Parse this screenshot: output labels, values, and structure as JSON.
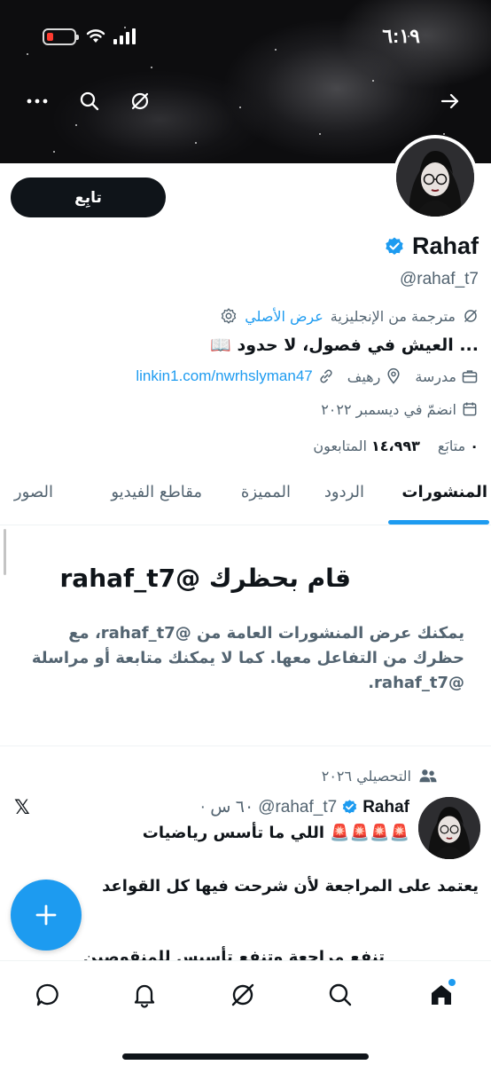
{
  "status_bar": {
    "time": "٦:١٩"
  },
  "profile": {
    "display_name": "Rahaf",
    "handle": "@rahaf_t7",
    "follow_label": "تابِع",
    "translated_label": "مترجمة من الإنجليزية",
    "show_original_label": "عرض الأصلي",
    "bio": "... العيش في فصول، لا حدود 📖",
    "profession": "مدرسة",
    "location": "رهيف",
    "website": "linkin1.com/nwrhslyman47",
    "joined": "انضمّ في ديسمبر ٢٠٢٢",
    "following_count": "٠",
    "following_label": "متابَع",
    "followers_count": "١٤،٩٩٣",
    "followers_label": "المتابعون"
  },
  "tabs": [
    {
      "label": "المنشورات",
      "active": true
    },
    {
      "label": "الردود",
      "active": false
    },
    {
      "label": "المميزة",
      "active": false
    },
    {
      "label": "مقاطع الفيديو",
      "active": false
    },
    {
      "label": "الصور",
      "active": false
    }
  ],
  "blocked_notice": {
    "title": "قام بحظرك @rahaf_t7",
    "text": "يمكنك عرض المنشورات العامة من @rahaf_t7، مع حظرك من التفاعل معها. كما لا يمكنك متابعة أو مراسلة @rahaf_t7."
  },
  "post": {
    "community": "التحصيلي ٢٠٢٦",
    "author_name": "Rahaf",
    "author_handle": "@rahaf_t7",
    "time": "· ٦٠ س",
    "line1": "🚨🚨🚨🚨 اللي ما تأسس رياضيات",
    "line2": "يعتمد على المراجعة لأن شرحت فيها كل القواعد",
    "line3": "تنفع مراجعة وتنفع تأسيس للمنقوصين"
  },
  "icons": {
    "header": [
      "back-arrow-icon",
      "grok-icon",
      "search-icon",
      "more-icon"
    ],
    "nav": [
      "home-icon",
      "search-icon",
      "grok-icon",
      "notifications-icon",
      "messages-icon"
    ]
  },
  "colors": {
    "accent": "#1d9bf0",
    "text": "#0f1419",
    "secondary": "#536471"
  }
}
